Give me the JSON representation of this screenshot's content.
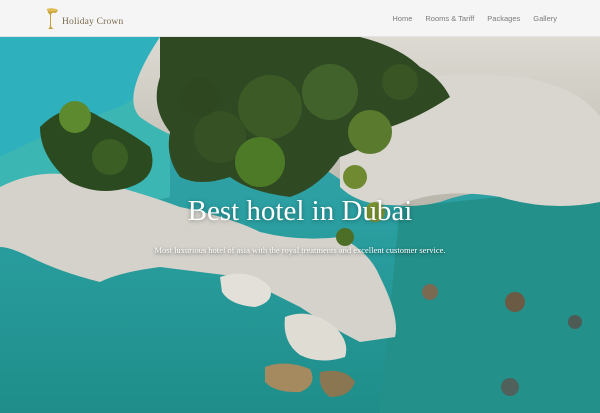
{
  "brand": {
    "name": "Holiday Crown",
    "logo_icon": "crown-cup-icon",
    "logo_color": "#c9a13a"
  },
  "nav": {
    "items": [
      {
        "label": "Home"
      },
      {
        "label": "Rooms & Tariff"
      },
      {
        "label": "Packages"
      },
      {
        "label": "Gallery"
      }
    ]
  },
  "hero": {
    "title": "Best hotel in Dubai",
    "subtitle": "Most luxurious hotel of asia with the royal treatments and excellent customer service."
  }
}
